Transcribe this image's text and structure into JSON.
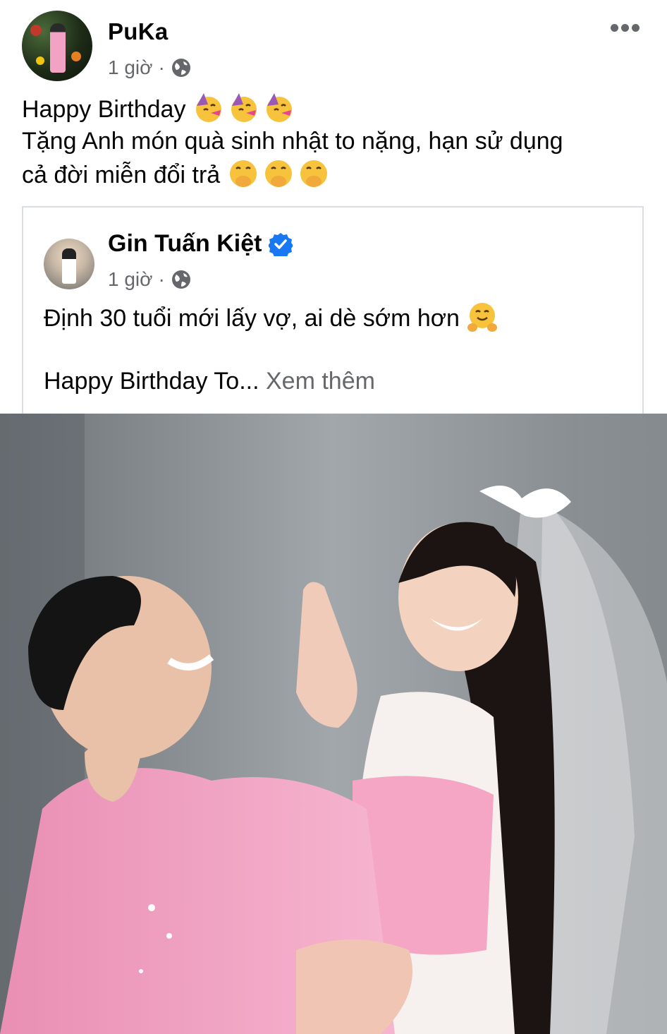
{
  "post": {
    "author": "PuKa",
    "time": "1 giờ",
    "separator": "·",
    "line1": "Happy Birthday",
    "line2": "Tặng Anh món quà sinh nhật to nặng, hạn sử dụng",
    "line3": "cả đời miễn đổi trả"
  },
  "shared": {
    "author": "Gin Tuấn Kiệt",
    "time": "1 giờ",
    "separator": "·",
    "line1": "Định 30 tuổi mới lấy vợ, ai dè sớm hơn",
    "line2": "Happy Birthday To...",
    "see_more": "Xem thêm"
  },
  "icons": {
    "more": "more-options-icon",
    "audience": "globe-icon",
    "verified": "verified-badge-icon",
    "party_emoji": "partying-face-emoji",
    "hand_over_mouth_emoji": "face-with-hand-over-mouth-emoji",
    "hug_emoji": "hugging-face-emoji"
  },
  "colors": {
    "text": "#050505",
    "secondary": "#65676b",
    "verified": "#1877f2",
    "border": "#dadde1",
    "shirt_pink": "#f4a6c4"
  }
}
